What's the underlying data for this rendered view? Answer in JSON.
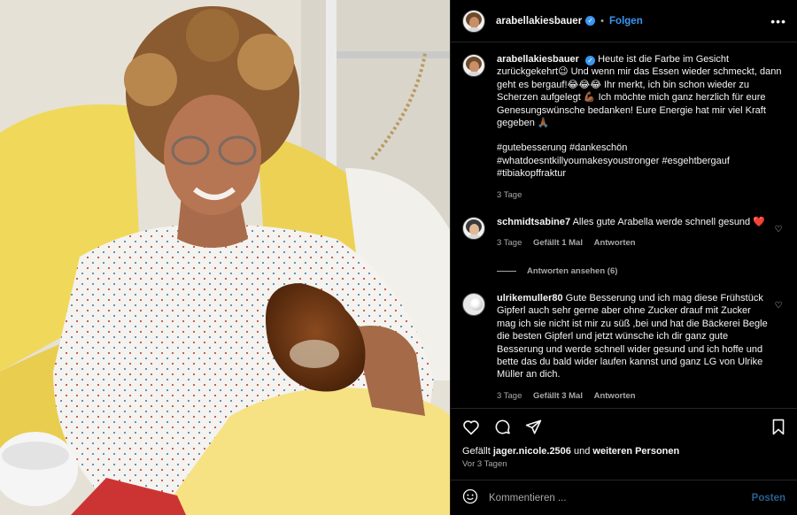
{
  "header": {
    "username": "arabellakiesbauer",
    "dot": "•",
    "follow_label": "Folgen",
    "more": "•••"
  },
  "caption": {
    "username": "arabellakiesbauer",
    "text": "Heute ist die Farbe im Gesicht zurückgekehrt😉 Und wenn mir das Essen wieder schmeckt, dann geht es bergauf!😂😂😂 Ihr merkt, ich bin schon wieder zu Scherzen aufgelegt 💪🏾 Ich möchte mich ganz herzlich für eure Genesungswünsche bedanken! Eure Energie hat mir viel Kraft gegeben 🙏🏾",
    "hashtags_1": "#gutebesserung #dankeschön",
    "hashtags_2": "#whatdoesntkillyoumakesyoustronger #esgehtbergauf",
    "hashtags_3": "#tibiakopffraktur",
    "time": "3 Tage"
  },
  "comments": [
    {
      "username": "schmidtsabine7",
      "text": "Alles gute Arabella werde schnell gesund ❤️",
      "time": "3 Tage",
      "likes": "Gefällt 1 Mal",
      "reply": "Antworten",
      "view_replies": "Antworten ansehen (6)"
    },
    {
      "username": "ulrikemuller80",
      "text": "Gute Besserung und ich mag diese Frühstück Gipferl auch sehr gerne aber ohne Zucker drauf mit Zucker mag ich sie nicht ist mir zu süß ,bei und hat die Bäckerei Begle die besten Gipferl und jetzt wünsche ich dir ganz gute Besserung und werde schnell wider gesund und ich hoffe und bette das du bald wider laufen kannst und ganz LG von Ulrike Müller an dich.",
      "time": "3 Tage",
      "likes": "Gefällt 3 Mal",
      "reply": "Antworten"
    }
  ],
  "liked_by": {
    "prefix": "Gefällt",
    "user": "jager.nicole.2506",
    "middle": "und",
    "suffix": "weiteren Personen"
  },
  "post_date": "Vor 3 Tagen",
  "comment_box": {
    "placeholder": "Kommentieren ...",
    "post_label": "Posten"
  },
  "colors": {
    "accent": "#3897f0",
    "background": "#000000",
    "muted": "#a8a8a8"
  }
}
